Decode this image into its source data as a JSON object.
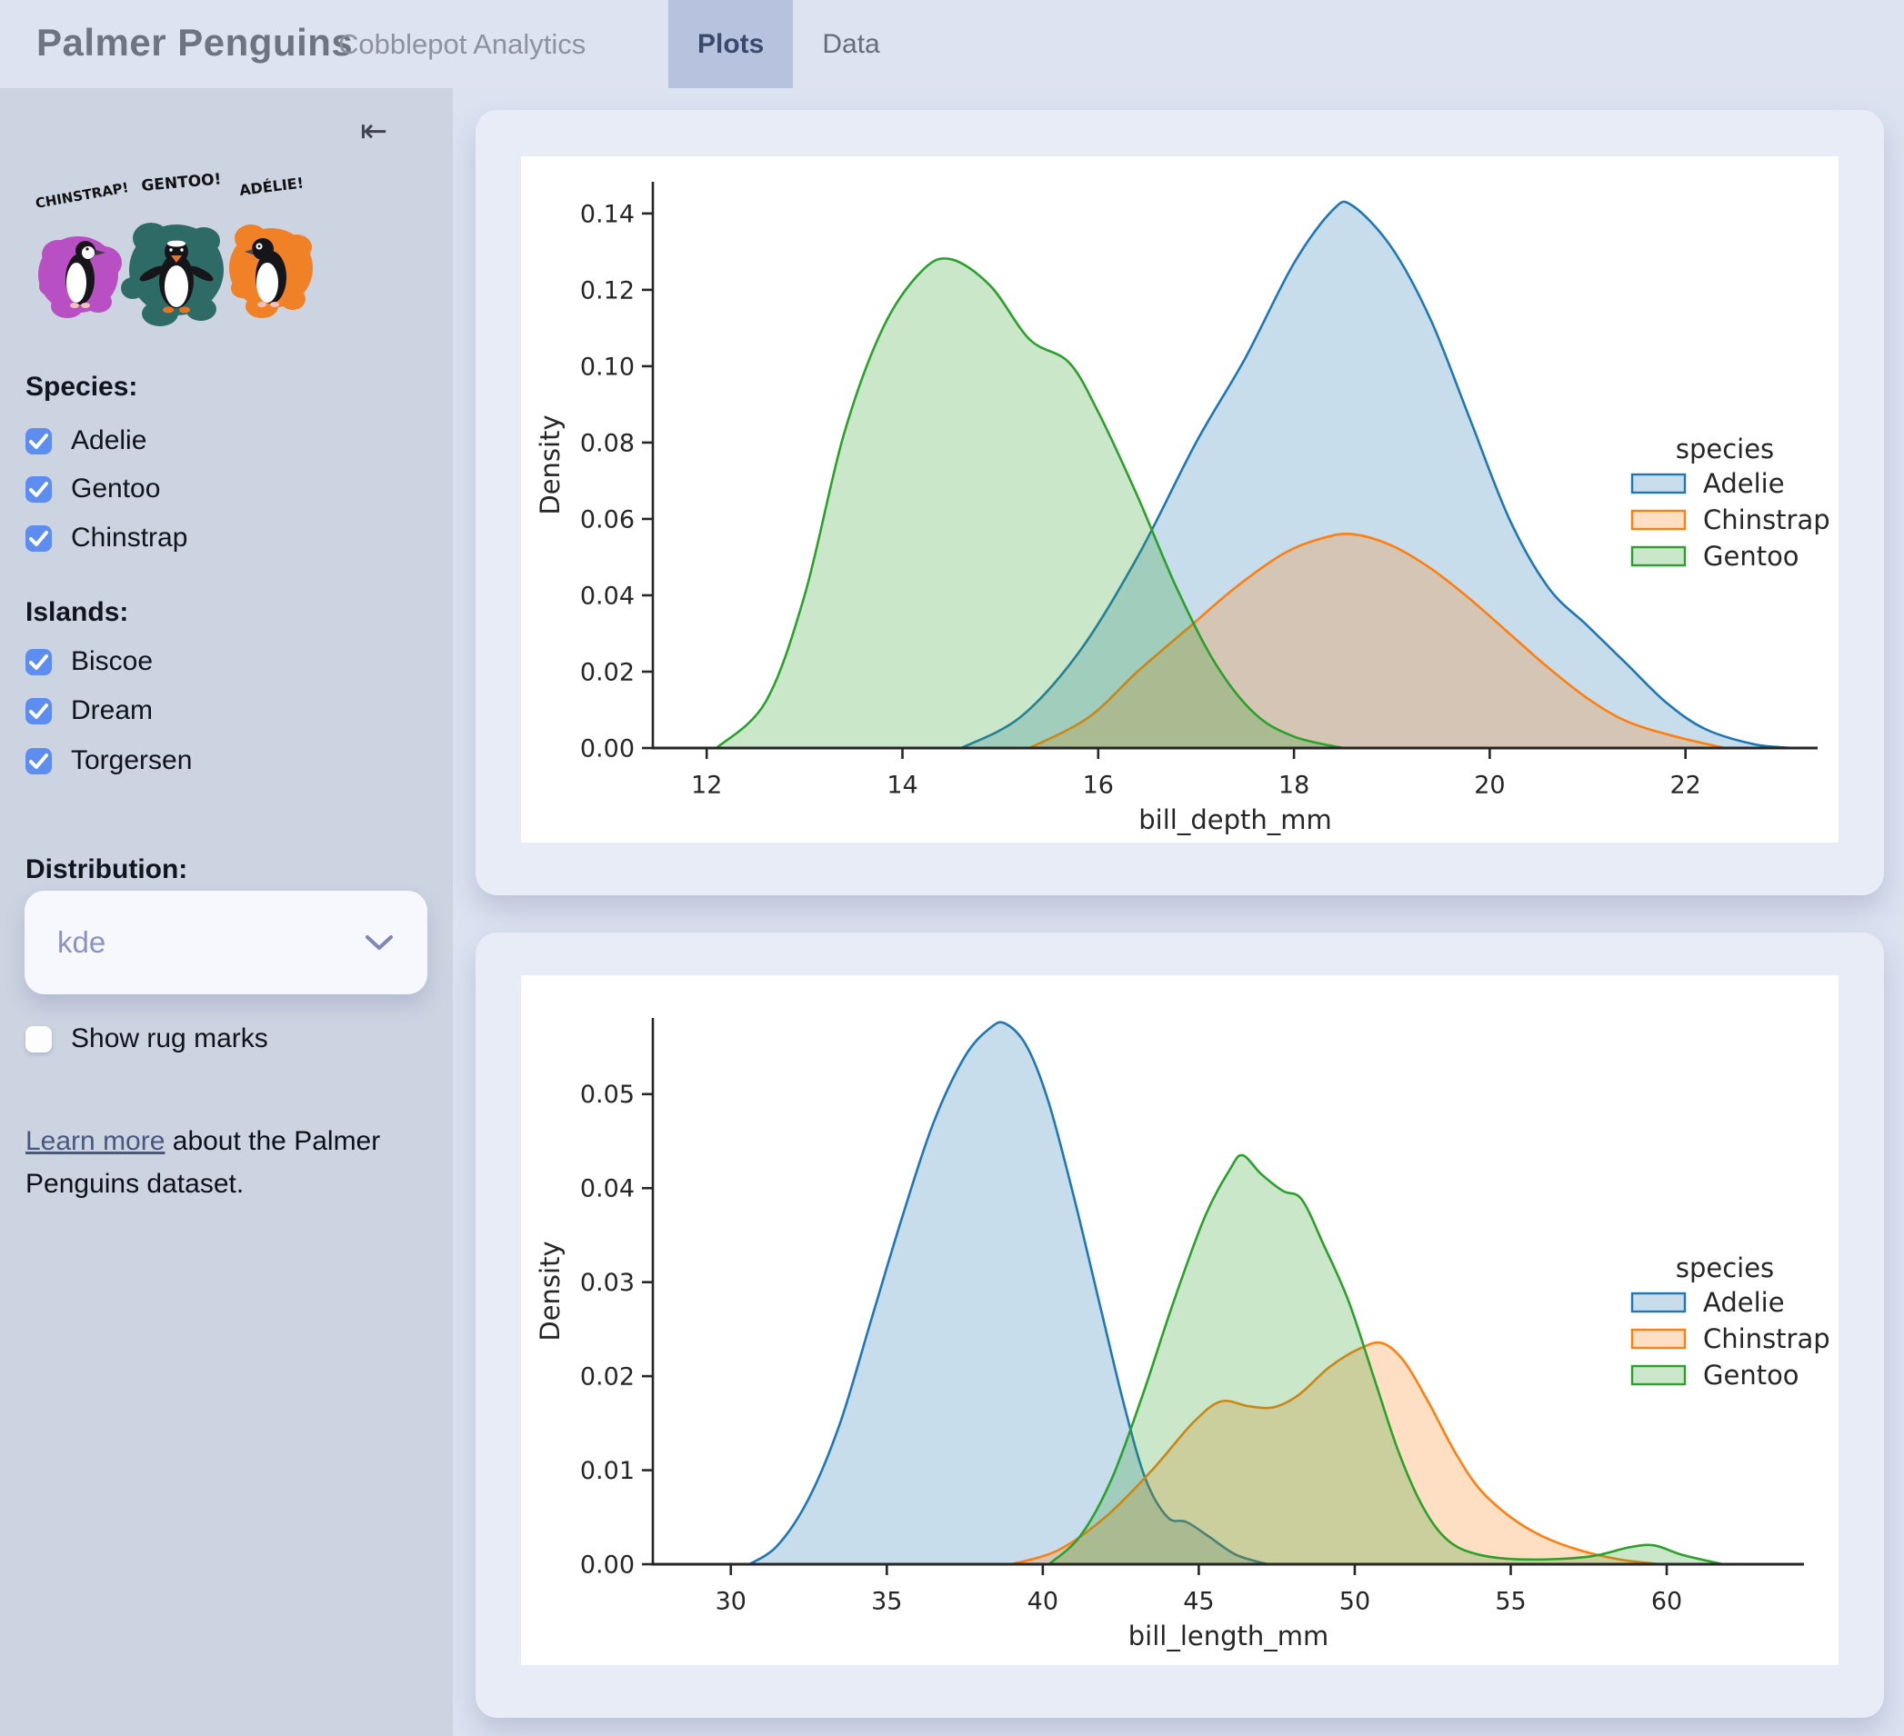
{
  "header": {
    "title": "Palmer Penguins",
    "subtitle": "Cobblepot Analytics",
    "tabs": [
      {
        "label": "Plots",
        "active": true
      },
      {
        "label": "Data",
        "active": false
      }
    ]
  },
  "sidebar": {
    "collapse_icon": "⇤",
    "artwork_labels": [
      "CHINSTRAP!",
      "GENTOO!",
      "ADÉLIE!"
    ],
    "artwork_colors": {
      "chinstrap": "#b84fc3",
      "gentoo": "#2f6b66",
      "adelie": "#f08127"
    },
    "species_label": "Species:",
    "species": [
      {
        "label": "Adelie",
        "checked": true
      },
      {
        "label": "Gentoo",
        "checked": true
      },
      {
        "label": "Chinstrap",
        "checked": true
      }
    ],
    "islands_label": "Islands:",
    "islands": [
      {
        "label": "Biscoe",
        "checked": true
      },
      {
        "label": "Dream",
        "checked": true
      },
      {
        "label": "Torgersen",
        "checked": true
      }
    ],
    "distribution_label": "Distribution:",
    "distribution_value": "kde",
    "rug": {
      "label": "Show rug marks",
      "checked": false
    },
    "learn_more_link": "Learn more",
    "learn_more_rest": " about the Palmer Penguins dataset."
  },
  "colors": {
    "accent_checkbox": "#5d8df1",
    "tab_active_bg": "#b7c3de",
    "adelie": "#1f77b4",
    "chinstrap": "#ff7f0e",
    "gentoo": "#2ca02c"
  },
  "chart_data": [
    {
      "type": "area",
      "title": "",
      "xlabel": "bill_depth_mm",
      "ylabel": "Density",
      "xlim": [
        11.45,
        23.35
      ],
      "ylim": [
        0,
        0.1483
      ],
      "xticks": [
        12,
        14,
        16,
        18,
        20,
        22
      ],
      "yticks": [
        0.0,
        0.02,
        0.04,
        0.06,
        0.08,
        0.1,
        0.12,
        0.14
      ],
      "legend_title": "species",
      "legend_position": "right",
      "grid": false,
      "series": [
        {
          "name": "Adelie",
          "color": "#1f77b4",
          "points": [
            [
              14.6,
              0
            ],
            [
              15.2,
              0.008
            ],
            [
              15.8,
              0.025
            ],
            [
              16.4,
              0.05
            ],
            [
              17.0,
              0.08
            ],
            [
              17.5,
              0.102
            ],
            [
              18.0,
              0.127
            ],
            [
              18.4,
              0.141
            ],
            [
              18.6,
              0.142
            ],
            [
              19.0,
              0.131
            ],
            [
              19.4,
              0.112
            ],
            [
              19.8,
              0.086
            ],
            [
              20.2,
              0.06
            ],
            [
              20.6,
              0.042
            ],
            [
              21.0,
              0.032
            ],
            [
              21.4,
              0.022
            ],
            [
              21.8,
              0.012
            ],
            [
              22.2,
              0.005
            ],
            [
              22.7,
              0.001
            ],
            [
              23.1,
              0
            ]
          ]
        },
        {
          "name": "Chinstrap",
          "color": "#ff7f0e",
          "points": [
            [
              15.3,
              0
            ],
            [
              15.9,
              0.008
            ],
            [
              16.4,
              0.02
            ],
            [
              16.9,
              0.031
            ],
            [
              17.4,
              0.042
            ],
            [
              17.9,
              0.051
            ],
            [
              18.3,
              0.055
            ],
            [
              18.6,
              0.056
            ],
            [
              19.0,
              0.053
            ],
            [
              19.4,
              0.047
            ],
            [
              19.8,
              0.039
            ],
            [
              20.2,
              0.03
            ],
            [
              20.6,
              0.021
            ],
            [
              21.0,
              0.013
            ],
            [
              21.4,
              0.007
            ],
            [
              21.9,
              0.003
            ],
            [
              22.4,
              0
            ]
          ]
        },
        {
          "name": "Gentoo",
          "color": "#2ca02c",
          "points": [
            [
              12.1,
              0
            ],
            [
              12.6,
              0.012
            ],
            [
              13.0,
              0.04
            ],
            [
              13.4,
              0.082
            ],
            [
              13.8,
              0.11
            ],
            [
              14.2,
              0.125
            ],
            [
              14.5,
              0.128
            ],
            [
              14.9,
              0.121
            ],
            [
              15.3,
              0.107
            ],
            [
              15.7,
              0.101
            ],
            [
              16.0,
              0.088
            ],
            [
              16.4,
              0.066
            ],
            [
              16.8,
              0.042
            ],
            [
              17.2,
              0.022
            ],
            [
              17.6,
              0.009
            ],
            [
              18.0,
              0.003
            ],
            [
              18.5,
              0
            ]
          ]
        }
      ]
    },
    {
      "type": "area",
      "title": "",
      "xlabel": "bill_length_mm",
      "ylabel": "Density",
      "xlim": [
        27.5,
        64.4
      ],
      "ylim": [
        0,
        0.0581
      ],
      "xticks": [
        30,
        35,
        40,
        45,
        50,
        55,
        60
      ],
      "yticks": [
        0.0,
        0.01,
        0.02,
        0.03,
        0.04,
        0.05
      ],
      "legend_title": "species",
      "legend_position": "right",
      "grid": false,
      "series": [
        {
          "name": "Adelie",
          "color": "#1f77b4",
          "points": [
            [
              30.6,
              0
            ],
            [
              31.5,
              0.002
            ],
            [
              32.5,
              0.007
            ],
            [
              33.5,
              0.015
            ],
            [
              34.5,
              0.026
            ],
            [
              35.5,
              0.037
            ],
            [
              36.5,
              0.047
            ],
            [
              37.5,
              0.054
            ],
            [
              38.3,
              0.057
            ],
            [
              38.8,
              0.0575
            ],
            [
              39.5,
              0.055
            ],
            [
              40.2,
              0.049
            ],
            [
              41.0,
              0.039
            ],
            [
              41.8,
              0.028
            ],
            [
              42.6,
              0.017
            ],
            [
              43.3,
              0.009
            ],
            [
              44.0,
              0.005
            ],
            [
              44.6,
              0.0045
            ],
            [
              45.3,
              0.003
            ],
            [
              46.2,
              0.001
            ],
            [
              47.2,
              0
            ]
          ]
        },
        {
          "name": "Chinstrap",
          "color": "#ff7f0e",
          "points": [
            [
              39.0,
              0
            ],
            [
              40.5,
              0.0015
            ],
            [
              42.0,
              0.005
            ],
            [
              43.5,
              0.01
            ],
            [
              44.8,
              0.015
            ],
            [
              45.7,
              0.0173
            ],
            [
              46.6,
              0.0168
            ],
            [
              47.4,
              0.0167
            ],
            [
              48.2,
              0.018
            ],
            [
              49.2,
              0.021
            ],
            [
              50.2,
              0.023
            ],
            [
              50.9,
              0.0235
            ],
            [
              51.6,
              0.0215
            ],
            [
              52.4,
              0.017
            ],
            [
              53.2,
              0.012
            ],
            [
              54.0,
              0.008
            ],
            [
              55.0,
              0.005
            ],
            [
              56.0,
              0.003
            ],
            [
              57.2,
              0.0015
            ],
            [
              58.5,
              0.0005
            ],
            [
              59.8,
              0
            ]
          ]
        },
        {
          "name": "Gentoo",
          "color": "#2ca02c",
          "points": [
            [
              40.2,
              0
            ],
            [
              41.2,
              0.003
            ],
            [
              42.2,
              0.009
            ],
            [
              43.2,
              0.018
            ],
            [
              44.2,
              0.028
            ],
            [
              45.2,
              0.037
            ],
            [
              46.0,
              0.042
            ],
            [
              46.4,
              0.0435
            ],
            [
              47.0,
              0.0415
            ],
            [
              47.7,
              0.0397
            ],
            [
              48.3,
              0.0388
            ],
            [
              49.0,
              0.034
            ],
            [
              49.8,
              0.028
            ],
            [
              50.6,
              0.02
            ],
            [
              51.4,
              0.012
            ],
            [
              52.2,
              0.006
            ],
            [
              53.0,
              0.0025
            ],
            [
              54.0,
              0.001
            ],
            [
              55.5,
              0.0005
            ],
            [
              57.5,
              0.0008
            ],
            [
              58.8,
              0.0018
            ],
            [
              59.6,
              0.002
            ],
            [
              60.5,
              0.001
            ],
            [
              61.8,
              0
            ]
          ]
        }
      ]
    }
  ]
}
